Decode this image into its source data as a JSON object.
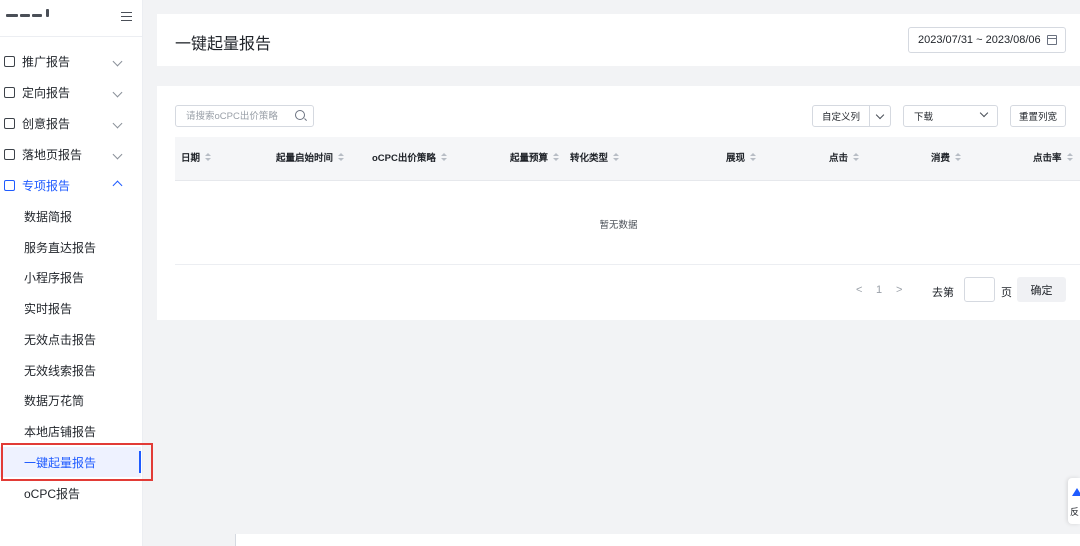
{
  "sidebar": {
    "groups": [
      {
        "label": "推广报告",
        "icon": "report-icon"
      },
      {
        "label": "定向报告",
        "icon": "target-icon"
      },
      {
        "label": "创意报告",
        "icon": "creative-icon"
      },
      {
        "label": "落地页报告",
        "icon": "landing-page-icon"
      },
      {
        "label": "专项报告",
        "icon": "special-report-icon",
        "expanded": true
      }
    ],
    "sub_items": [
      "数据简报",
      "服务直达报告",
      "小程序报告",
      "实时报告",
      "无效点击报告",
      "无效线索报告",
      "数据万花筒",
      "本地店铺报告",
      "一键起量报告",
      "oCPC报告"
    ],
    "selected": "一键起量报告"
  },
  "header": {
    "title": "一键起量报告",
    "date_range": "2023/07/31 ~ 2023/08/06"
  },
  "toolbar": {
    "search_placeholder": "请搜索oCPC出价策略",
    "custom_columns": "自定义列",
    "download": "下载",
    "reset_width": "重置列宽"
  },
  "table": {
    "columns": [
      "日期",
      "起量启始时间",
      "oCPC出价策略",
      "起量预算",
      "转化类型",
      "展现",
      "点击",
      "消费",
      "点击率"
    ],
    "empty_text": "暂无数据"
  },
  "pagination": {
    "current_page": "1",
    "goto_label": "去第",
    "page_unit": "页",
    "confirm": "确定"
  },
  "feedback": {
    "label": "反"
  },
  "colors": {
    "accent": "#1f5bff",
    "highlight_border": "#e23b36"
  }
}
